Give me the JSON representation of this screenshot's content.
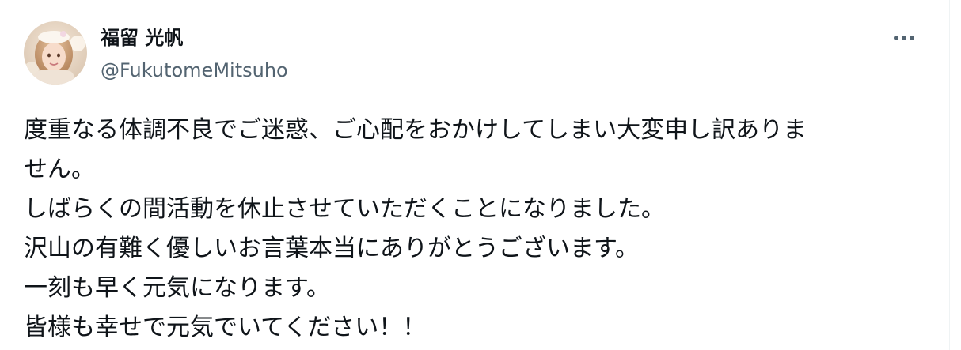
{
  "author": {
    "display_name": "福留 光帆",
    "handle": "@FukutomeMitsuho",
    "avatar_icon": "user-avatar-photo"
  },
  "menu": {
    "icon": "more-horizontal-icon"
  },
  "tweet": {
    "lines": [
      "度重なる体調不良でご迷惑、ご心配をおかけしてしまい大変申し訳ありま",
      "せん。",
      "しばらくの間活動を休止させていただくことになりました。",
      "沢山の有難く優しいお言葉本当にありがとうございます。",
      "一刻も早く元気になります。",
      "皆様も幸せで元気でいてください！！"
    ]
  },
  "colors": {
    "text_primary": "#0f1419",
    "text_secondary": "#536471",
    "background": "#ffffff",
    "divider": "#eff3f4"
  }
}
